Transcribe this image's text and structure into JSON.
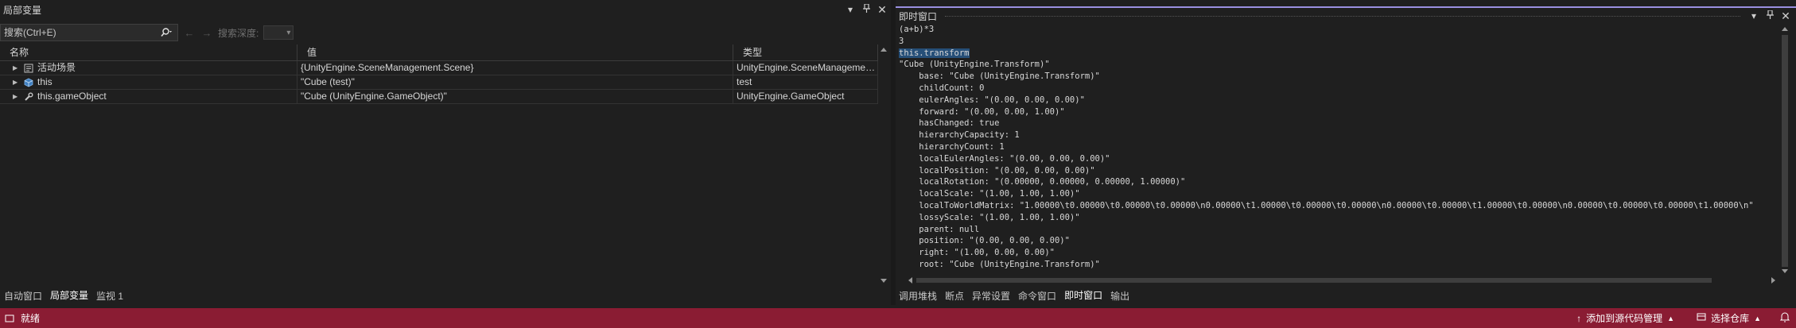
{
  "locals_panel": {
    "title": "局部变量",
    "search_placeholder": "搜索(Ctrl+E)",
    "search_depth_label": "搜索深度:",
    "columns": {
      "name": "名称",
      "value": "值",
      "type": "类型"
    },
    "rows": [
      {
        "name": "活动场景",
        "value": "{UnityEngine.SceneManagement.Scene}",
        "type": "UnityEngine.SceneManagemen...",
        "icon": "module-icon"
      },
      {
        "name": "this",
        "value": "\"Cube (test)\"",
        "type": "test",
        "icon": "object-cube-icon"
      },
      {
        "name": "this.gameObject",
        "value": "\"Cube (UnityEngine.GameObject)\"",
        "type": "UnityEngine.GameObject",
        "icon": "wrench-icon"
      }
    ],
    "tabs": [
      "自动窗口",
      "局部变量",
      "监视 1"
    ],
    "active_tab": "局部变量"
  },
  "immediate_panel": {
    "title": "即时窗口",
    "lines": [
      "(a+b)*3",
      "3",
      "this.transform",
      "\"Cube (UnityEngine.Transform)\"",
      "    base: \"Cube (UnityEngine.Transform)\"",
      "    childCount: 0",
      "    eulerAngles: \"(0.00, 0.00, 0.00)\"",
      "    forward: \"(0.00, 0.00, 1.00)\"",
      "    hasChanged: true",
      "    hierarchyCapacity: 1",
      "    hierarchyCount: 1",
      "    localEulerAngles: \"(0.00, 0.00, 0.00)\"",
      "    localPosition: \"(0.00, 0.00, 0.00)\"",
      "    localRotation: \"(0.00000, 0.00000, 0.00000, 1.00000)\"",
      "    localScale: \"(1.00, 1.00, 1.00)\"",
      "    localToWorldMatrix: \"1.00000\\t0.00000\\t0.00000\\t0.00000\\n0.00000\\t1.00000\\t0.00000\\t0.00000\\n0.00000\\t0.00000\\t1.00000\\t0.00000\\n0.00000\\t0.00000\\t0.00000\\t1.00000\\n\"",
      "    lossyScale: \"(1.00, 1.00, 1.00)\"",
      "    parent: null",
      "    position: \"(0.00, 0.00, 0.00)\"",
      "    right: \"(1.00, 0.00, 0.00)\"",
      "    root: \"Cube (UnityEngine.Transform)\""
    ],
    "highlighted_line": 2,
    "tabs": [
      "调用堆栈",
      "断点",
      "异常设置",
      "命令窗口",
      "即时窗口",
      "输出"
    ],
    "active_tab": "即时窗口"
  },
  "status_bar": {
    "status": "就绪",
    "source_control": "添加到源代码管理",
    "repository": "选择仓库"
  },
  "colors": {
    "background": "#1f1f1f",
    "status_bar": "#8a1c33",
    "title_accent": "#9a8fe0",
    "selection": "#264f78"
  }
}
